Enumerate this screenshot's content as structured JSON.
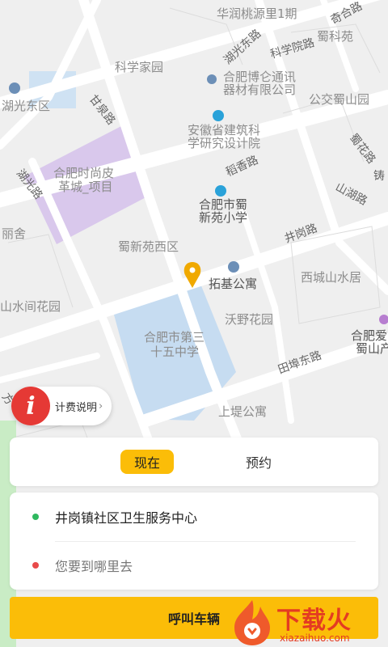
{
  "map": {
    "labels": {
      "huarun": "华润桃源里1期",
      "qihe": "奇合路",
      "shukeyuan": "蜀科苑",
      "huguang_road": "湖光东路",
      "kexueyuan_road": "科学院路",
      "kexuejiayuan": "科学家园",
      "hefei_bogu_1": "合肥博仑通讯",
      "hefei_bogu_2": "器材有限公司",
      "gongjiao": "公交蜀山园",
      "hudongqu": "湖光东区",
      "ganquan_road": "甘泉路",
      "anhui_1": "安徽省建筑科",
      "anhui_2": "学研究设计院",
      "shuhuan_road": "蜀花路",
      "huguang_road2": "湖光路",
      "daoxiang_road": "稻香路",
      "fashion_1": "合肥时尚皮",
      "fashion_2": "革城_项目",
      "shanhu_road": "山湖路",
      "school1_1": "合肥市蜀",
      "school1_2": "新苑小学",
      "lishe": "丽舍",
      "jinggang_road": "井岗路",
      "shuxinyuan": "蜀新苑西区",
      "xicheng": "西城山水居",
      "tuoji": "拓基公寓",
      "shanshui": "山水间花园",
      "woye": "沃野花园",
      "school35_1": "合肥市第三",
      "school35_2": "十五中学",
      "tianbu_road": "田埠东路",
      "aiyou_1": "合肥爱",
      "aiyou_2": "蜀山产",
      "shangdi": "上堤公寓",
      "fang": "方",
      "zhu": "铸"
    }
  },
  "fee": {
    "icon": "i",
    "label": "计费说明",
    "chevron": "›"
  },
  "mode_tabs": {
    "now": "现在",
    "reserve": "预约"
  },
  "route": {
    "from": "井岗镇社区卫生服务中心",
    "to_placeholder": "您要到哪里去"
  },
  "call_button": "呼叫车辆",
  "watermark": {
    "text": "下载火",
    "url": "xiazaihuo.com"
  },
  "colors": {
    "accent": "#fbbd08",
    "origin_dot": "#2fb85f",
    "destination_dot": "#e84a4a",
    "fee_icon": "#e53935",
    "watermark": "#e43b22"
  }
}
